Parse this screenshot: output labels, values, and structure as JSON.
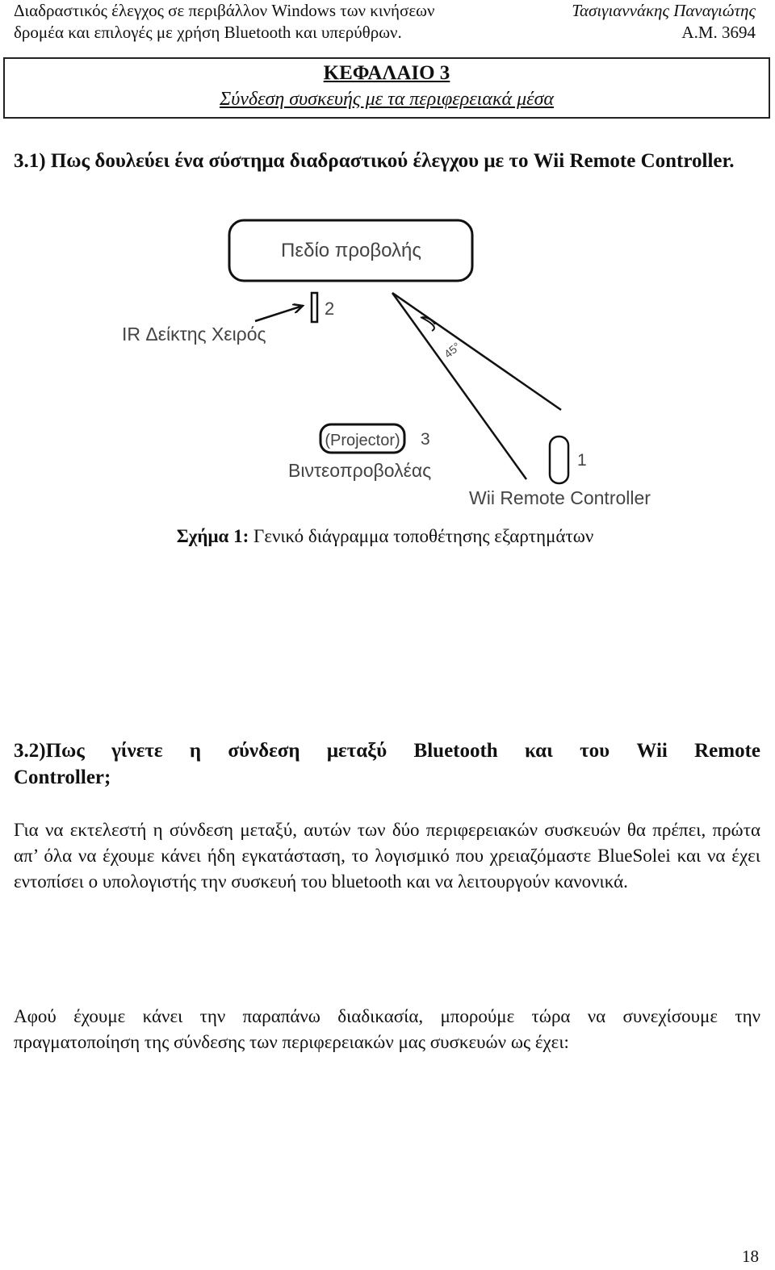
{
  "header": {
    "left_line1": "Διαδραστικός έλεγχος σε περιβάλλον Windows των κινήσεων",
    "left_line2": "δρομέα και επιλογές με χρήση Bluetooth και υπερύθρων.",
    "author": "Τασιγιαννάκης Παναγιώτης",
    "student_id": "Α.Μ. 3694"
  },
  "chapter": {
    "title": "ΚΕΦΑΛΑΙΟ 3",
    "subtitle": "Σύνδεση συσκευής με τα περιφερειακά μέσα"
  },
  "section1": {
    "heading": "3.1) Πως δουλεύει ένα  σύστημα  διαδραστικού έλεγχου με το Wii Remote Controller."
  },
  "diagram": {
    "projection_field_label": "Πεδίο προβολής",
    "ir_marker_number": "2",
    "ir_marker_label": "IR Δείκτης Χειρός",
    "angle_label": "45°",
    "projector_box_label": "(Projector)",
    "projector_number": "3",
    "projector_label": "Βιντεοπροβολέας",
    "wii_number": "1",
    "wii_label": "Wii Remote Controller"
  },
  "figure_caption": {
    "prefix": "Σχήμα 1:",
    "text": " Γενικό διάγραμμα τοποθέτησης εξαρτημάτων"
  },
  "section2": {
    "heading_line1": "3.2)Πως γίνετε η σύνδεση μεταξύ  Bluetooth και του Wii Remote",
    "heading_line2": "Controller;"
  },
  "paragraphs": [
    "Για να εκτελεστή η σύνδεση μεταξύ, αυτών των δύο περιφερειακών συσκευών θα πρέπει, πρώτα απ’ όλα να έχουμε κάνει ήδη εγκατάσταση, το λογισμικό που χρειαζόμαστε BlueSolei  και να έχει εντοπίσει ο υπολογιστής την συσκευή του bluetooth και να λειτουργούν κανονικά.",
    "Αφού έχουμε κάνει την παραπάνω διαδικασία, μπορούμε τώρα να συνεχίσουμε την πραγματοποίηση της σύνδεσης των περιφερειακών μας συσκευών ως έχει:"
  ],
  "page_number": "18"
}
